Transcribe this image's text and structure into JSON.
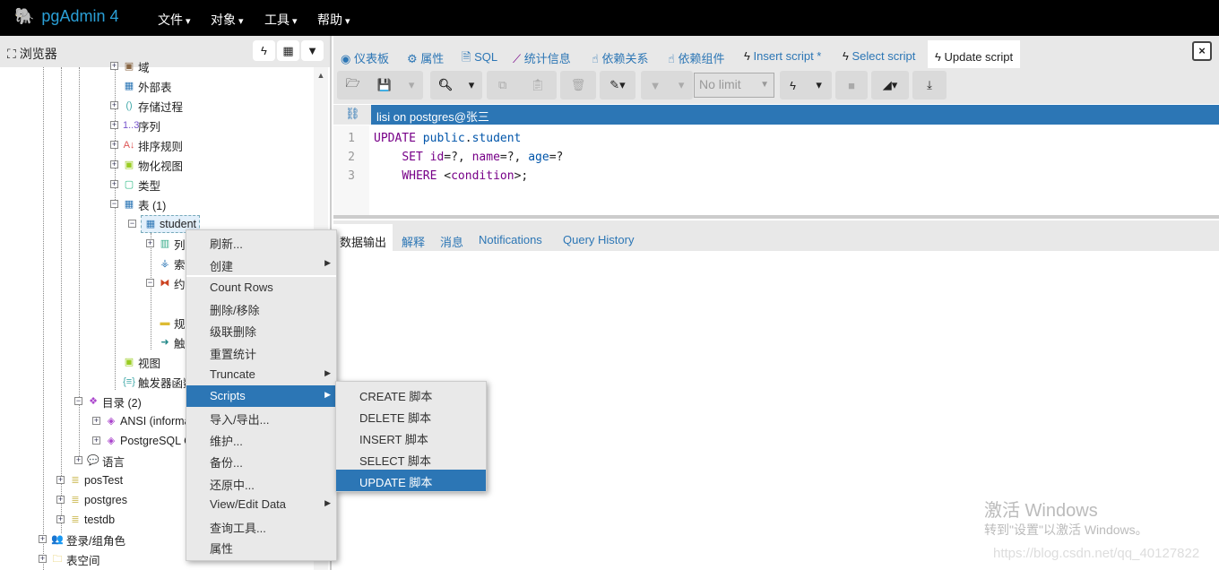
{
  "app": {
    "title": "pgAdmin 4",
    "menus": [
      "文件",
      "对象",
      "工具",
      "帮助"
    ]
  },
  "browser": {
    "title": "浏览器",
    "tree": [
      "域",
      "外部表",
      "存储过程",
      "序列",
      "排序规则",
      "物化视图",
      "类型",
      "表 (1)",
      "student",
      "列",
      "索引",
      "约束",
      "",
      "规则",
      "触发器",
      "视图",
      "触发器函数",
      "目录 (2)",
      "ANSI (information_schema)",
      "PostgreSQL Catalog",
      "语言",
      "posTest",
      "postgres",
      "testdb",
      "登录/组角色",
      "表空间"
    ]
  },
  "tabs": [
    {
      "label": "仪表板",
      "icon": "dashboard-icon"
    },
    {
      "label": "属性",
      "icon": "gears-icon"
    },
    {
      "label": "SQL",
      "icon": "file-icon"
    },
    {
      "label": "统计信息",
      "icon": "chart-icon"
    },
    {
      "label": "依赖关系",
      "icon": "hand-icon"
    },
    {
      "label": "依赖组件",
      "icon": "hand-icon"
    },
    {
      "label": "Insert script *",
      "icon": "bolt-icon"
    },
    {
      "label": "Select script",
      "icon": "bolt-icon"
    },
    {
      "label": "Update script",
      "icon": "bolt-icon",
      "active": true
    }
  ],
  "toolbar": {
    "limit": "No limit"
  },
  "connection": "lisi on postgres@张三",
  "editor": {
    "lines": [
      "1",
      "2",
      "3"
    ]
  },
  "result_tabs": [
    "数据输出",
    "解释",
    "消息",
    "Notifications",
    "Query History"
  ],
  "context_menu": [
    "刷新...",
    "创建",
    "Count Rows",
    "删除/移除",
    "级联删除",
    "重置统计",
    "Truncate",
    "Scripts",
    "导入/导出...",
    "维护...",
    "备份...",
    "还原中...",
    "View/Edit Data",
    "查询工具...",
    "属性"
  ],
  "submenu": [
    "CREATE 脚本",
    "DELETE 脚本",
    "INSERT 脚本",
    "SELECT 脚本",
    "UPDATE 脚本"
  ],
  "watermark": {
    "line1": "激活 Windows",
    "line2": "转到\"设置\"以激活 Windows。",
    "url": "https://blog.csdn.net/qq_40127822"
  },
  "colors": {
    "accent": "#2c76b5",
    "topbar": "#000000"
  }
}
